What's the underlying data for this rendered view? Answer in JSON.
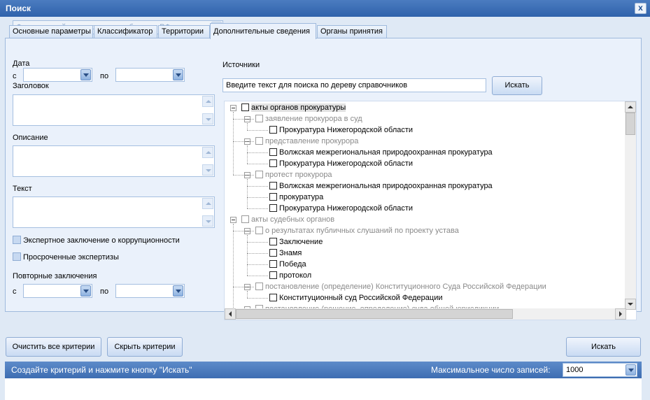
{
  "window": {
    "title": "Поиск",
    "close": "x"
  },
  "registry": {
    "selected": "Федеральный регистр - акты субъектов РФ"
  },
  "tabs": [
    {
      "label": "Основные параметры"
    },
    {
      "label": "Классификатор"
    },
    {
      "label": "Территории"
    },
    {
      "label": "Дополнительные сведения",
      "active": true
    },
    {
      "label": "Органы принятия"
    }
  ],
  "left": {
    "date_label": "Дата",
    "from_label": "с",
    "to_label": "по",
    "heading_label": "Заголовок",
    "description_label": "Описание",
    "text_label": "Текст",
    "check_corruption": "Экспертное заключение о коррупционности",
    "check_overdue": "Просроченные экспертизы",
    "repeat_label": "Повторные заключения",
    "repeat_from": "с",
    "repeat_to": "по"
  },
  "sources": {
    "label": "Источники",
    "search_value": "Введите текст для поиска по дереву справочников",
    "search_button": "Искать",
    "tree": [
      {
        "text": "акты органов прокуратуры",
        "level": 0,
        "gray": false,
        "highlight": true
      },
      {
        "text": "заявление прокурора в суд",
        "level": 1,
        "gray": true
      },
      {
        "text": "Прокуратура Нижегородской области",
        "level": 2,
        "gray": false
      },
      {
        "text": "представление прокурора",
        "level": 1,
        "gray": true
      },
      {
        "text": "Волжская межрегиональная природоохранная прокуратура",
        "level": 2,
        "gray": false
      },
      {
        "text": "Прокуратура Нижегородской области",
        "level": 2,
        "gray": false
      },
      {
        "text": "протест прокурора",
        "level": 1,
        "gray": true
      },
      {
        "text": "Волжская межрегиональная природоохранная прокуратура",
        "level": 2,
        "gray": false
      },
      {
        "text": "прокуратура",
        "level": 2,
        "gray": false
      },
      {
        "text": "Прокуратура Нижегородской области",
        "level": 2,
        "gray": false
      },
      {
        "text": "акты судебных органов",
        "level": 0,
        "gray": true
      },
      {
        "text": "о результатах публичных слушаний по проекту устава",
        "level": 1,
        "gray": true
      },
      {
        "text": "Заключение",
        "level": 2,
        "gray": false
      },
      {
        "text": "Знамя",
        "level": 2,
        "gray": false
      },
      {
        "text": "Победа",
        "level": 2,
        "gray": false
      },
      {
        "text": "протокол",
        "level": 2,
        "gray": false
      },
      {
        "text": "постановление (определение) Конституционного Суда Российской Федерации",
        "level": 1,
        "gray": true
      },
      {
        "text": "Конституционный суд Российской Федерации",
        "level": 2,
        "gray": false
      },
      {
        "text": "постановление (решение, определение) суда общей юрисдикции",
        "level": 1,
        "gray": true
      }
    ]
  },
  "buttons": {
    "clear": "Очистить все критерии",
    "hide": "Скрыть критерии",
    "search": "Искать"
  },
  "status": {
    "message": "Создайте критерий и нажмите кнопку \"Искать\"",
    "max_label": "Максимальное число записей:",
    "max_value": "1000"
  }
}
